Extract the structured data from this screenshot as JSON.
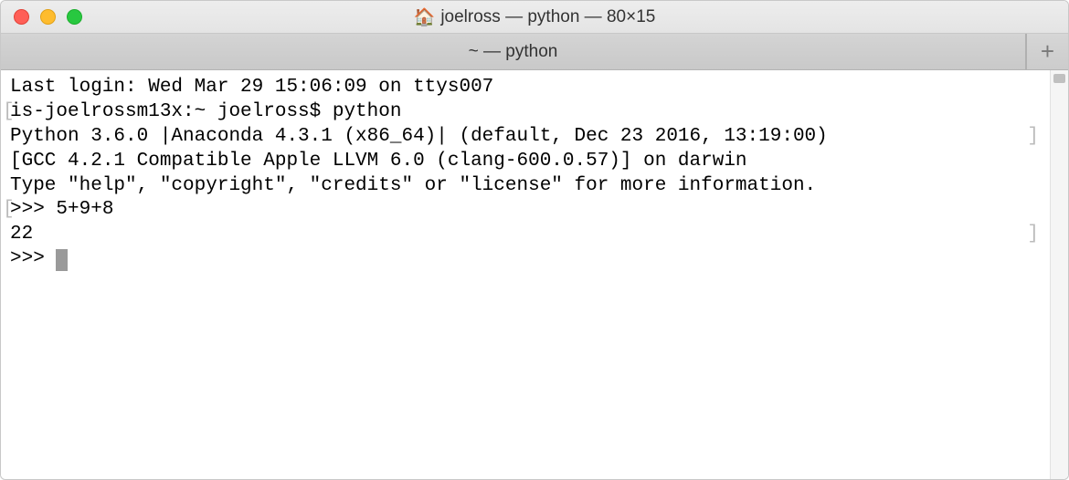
{
  "titlebar": {
    "title": "joelross — python — 80×15",
    "home_icon": "🏠"
  },
  "tabbar": {
    "tab_label": "~ — python",
    "new_tab_glyph": "+"
  },
  "terminal": {
    "lines": [
      "Last login: Wed Mar 29 15:06:09 on ttys007",
      "is-joelrossm13x:~ joelross$ python",
      "Python 3.6.0 |Anaconda 4.3.1 (x86_64)| (default, Dec 23 2016, 13:19:00) ",
      "[GCC 4.2.1 Compatible Apple LLVM 6.0 (clang-600.0.57)] on darwin",
      "Type \"help\", \"copyright\", \"credits\" or \"license\" for more information.",
      ">>> 5+9+8",
      "22",
      ">>> "
    ]
  }
}
